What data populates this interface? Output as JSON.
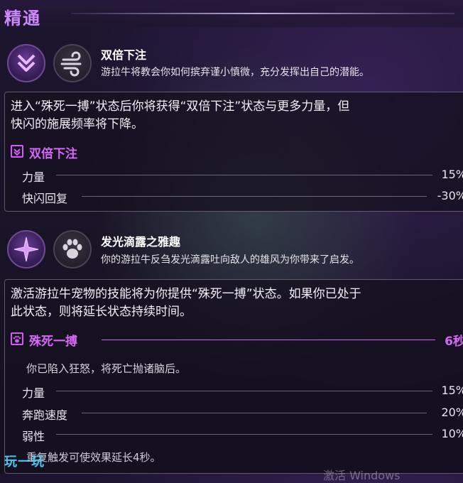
{
  "header": {
    "title": "精通"
  },
  "talents": [
    {
      "name": "双倍下注",
      "desc": "游拉牛将教会你如何摈弃谨小慎微，充分发挥出自己的潜能。",
      "icon_main": "double-chevron-down-icon",
      "icon_secondary": "wind-icon",
      "body_lines": [
        "进入“殊死一搏”状态后你将获得“双倍下注”状态与更多力量，但",
        "快闪的施展频率将下降。"
      ],
      "status": {
        "name": "双倍下注",
        "icon": "double-chevron-down-icon"
      },
      "stats": [
        {
          "label": "力量",
          "value": "15%"
        },
        {
          "label": "快闪回复",
          "value": "-30%"
        }
      ]
    },
    {
      "name": "发光滴露之雅趣",
      "desc": "你的游拉牛反刍发光滴露吐向敌人的雄风为你带来了启发。",
      "icon_main": "sparkle-star-icon",
      "icon_secondary": "paw-icon",
      "body_lines": [
        "激活游拉牛宠物的技能将为你提供“殊死一搏”状态。如果你已处于",
        "此状态，则将延长状态持续时间。"
      ],
      "status": {
        "name": "殊死一搏",
        "icon": "paw-icon",
        "duration": "6秒"
      },
      "flavor": "你已陷入狂怒，将死亡抛诸脑后。",
      "stats": [
        {
          "label": "力量",
          "value": "15%"
        },
        {
          "label": "奔跑速度",
          "value": "20%"
        },
        {
          "label": "弱性",
          "value": "10%"
        }
      ],
      "footnote": "重复触发可使效果延长4秒。"
    }
  ],
  "watermarks": {
    "site": "玩一玩",
    "windows": "激活 Windows"
  },
  "colors": {
    "accent": "#d767f5",
    "title": "#cc88ff"
  }
}
